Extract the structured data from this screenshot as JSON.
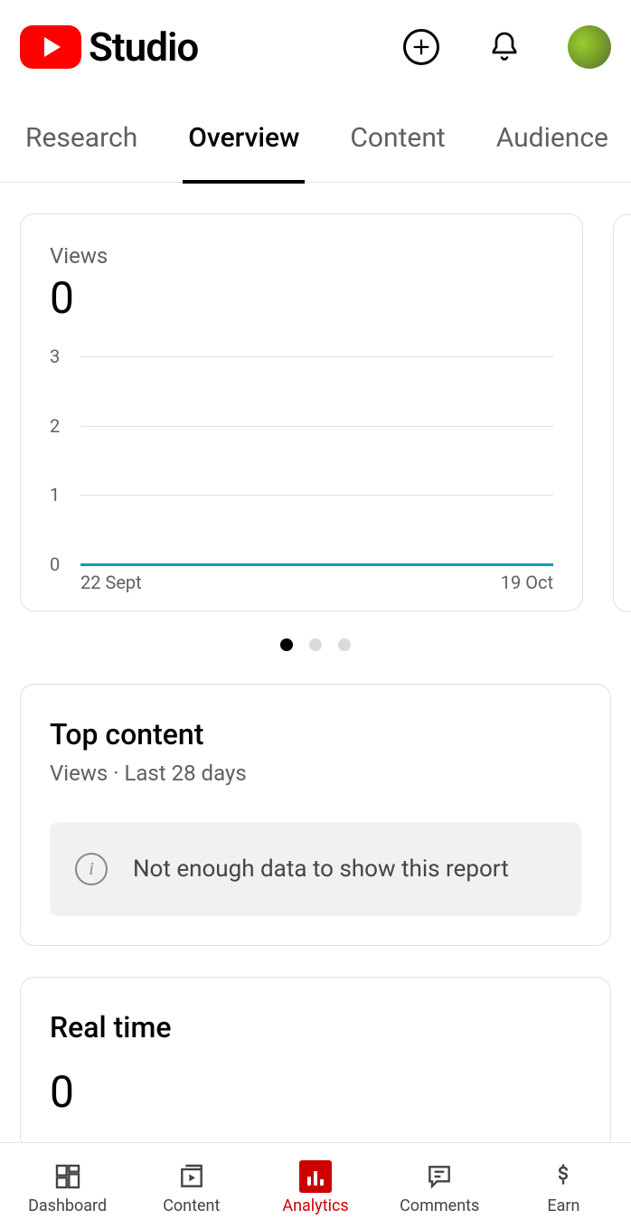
{
  "header": {
    "app_name": "Studio"
  },
  "tabs": [
    {
      "label": "Research",
      "active": false
    },
    {
      "label": "Overview",
      "active": true
    },
    {
      "label": "Content",
      "active": false
    },
    {
      "label": "Audience",
      "active": false
    }
  ],
  "views_card": {
    "label": "Views",
    "value": "0"
  },
  "chart_data": {
    "type": "line",
    "title": "Views",
    "xlabel": "",
    "ylabel": "",
    "ylim": [
      0,
      3
    ],
    "y_ticks": [
      "3",
      "2",
      "1",
      "0"
    ],
    "x_ticks": [
      "22 Sept",
      "19 Oct"
    ],
    "x": [
      "22 Sept",
      "19 Oct"
    ],
    "values": [
      0,
      0
    ]
  },
  "carousel": {
    "total": 3,
    "active_index": 0
  },
  "top_content": {
    "title": "Top content",
    "subtitle": "Views · Last 28 days",
    "info_message": "Not enough data to show this report"
  },
  "realtime": {
    "title": "Real time",
    "value": "0"
  },
  "bottom_nav": [
    {
      "label": "Dashboard",
      "active": false
    },
    {
      "label": "Content",
      "active": false
    },
    {
      "label": "Analytics",
      "active": true
    },
    {
      "label": "Comments",
      "active": false
    },
    {
      "label": "Earn",
      "active": false
    }
  ]
}
